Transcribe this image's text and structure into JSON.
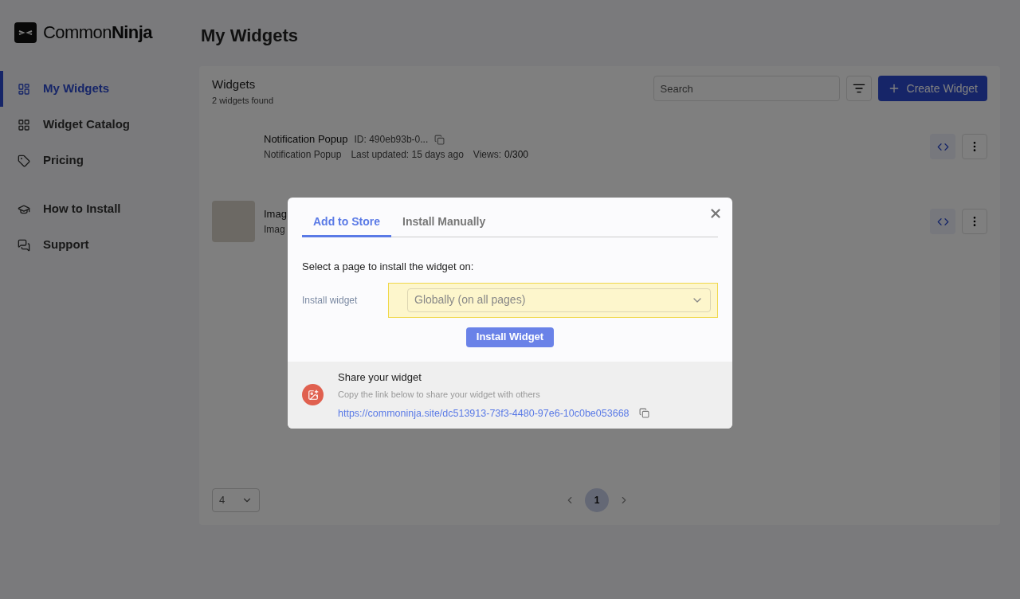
{
  "logo": "Common**Ninja**",
  "sidebar": {
    "sections": [
      [
        {
          "label": "My Widgets",
          "selected": true
        },
        {
          "label": "Widget Catalog",
          "selected": false
        },
        {
          "label": "Pricing",
          "selected": false
        }
      ],
      [
        {
          "label": "How to Install",
          "selected": false
        },
        {
          "label": "Support",
          "selected": false
        }
      ]
    ]
  },
  "page_title": "My Widgets",
  "widgets_panel": {
    "title": "Widgets",
    "count": "2 widgets found",
    "search": {
      "placeholder": "Search"
    },
    "create_button": "Create Widget",
    "rows": [
      {
        "has_photo": false,
        "title": "Notification Popup",
        "id": "ID: 490eb93b-0...",
        "type": "Notification Popup",
        "updated": "Last updated: 15 days ago",
        "views_label": "Views:",
        "views": "0/300"
      },
      {
        "has_photo": true,
        "title": "Imag",
        "subtitle": "Imag"
      }
    ],
    "page_size": "4",
    "pages": [
      {
        "label": "1",
        "selected": true
      }
    ]
  },
  "modal": {
    "tabs": [
      {
        "label": "Add to Store",
        "selected": true
      },
      {
        "label": "Install Manually",
        "selected": false
      }
    ],
    "prompt": "Select a page to install the widget on:",
    "field_label": "Install widget",
    "select_value": "Globally (on all pages)",
    "install_button": "Install Widget",
    "share": {
      "title": "Share your widget",
      "hint": "Copy the link below to share your widget with others",
      "link": "https://commoninja.site/dc513913-73f3-4480-97e6-10c0be053668"
    }
  }
}
